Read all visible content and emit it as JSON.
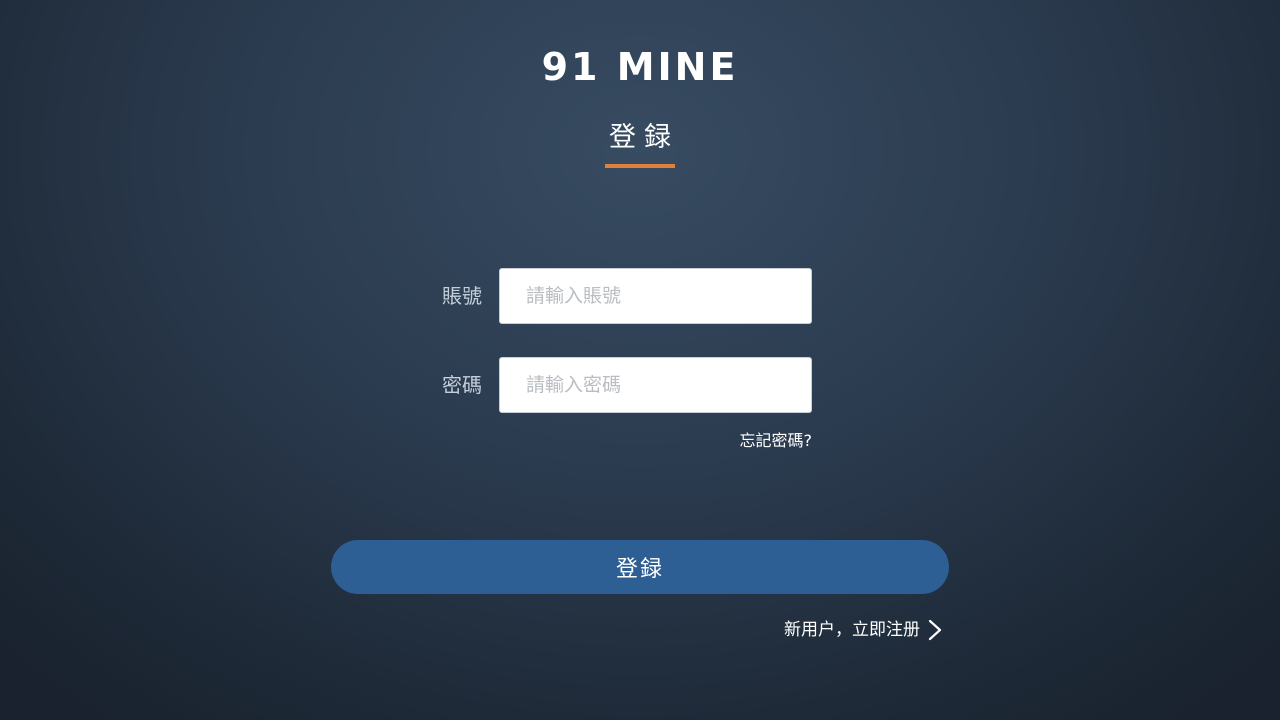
{
  "brand": {
    "logo_text": "91 MINE"
  },
  "header": {
    "title": "登録"
  },
  "form": {
    "account": {
      "label": "賬號",
      "placeholder": "請輸入賬號",
      "value": ""
    },
    "password": {
      "label": "密碼",
      "placeholder": "請輸入密碼",
      "value": ""
    },
    "forgot_label": "忘記密碼?",
    "submit_label": "登録"
  },
  "footer": {
    "register_label": "新用户，立即注册",
    "register_icon": "chevron-right-icon"
  },
  "colors": {
    "accent_underline": "#e0803a",
    "button_bg": "#2d5e94",
    "label_text": "#c3cedb"
  }
}
